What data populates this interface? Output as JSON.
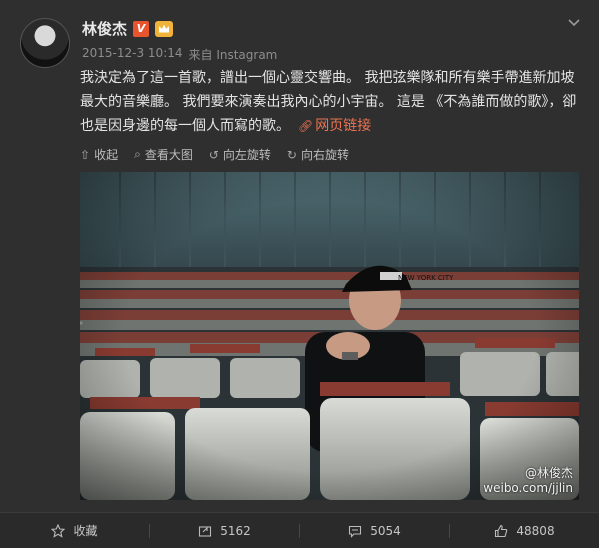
{
  "post": {
    "author_name": "林俊杰",
    "verified_badge": "V",
    "timestamp": "2015-12-3 10:14",
    "source": "来自 Instagram",
    "text": "我決定為了這一首歌，譜出一個心靈交響曲。 我把弦樂隊和所有樂手帶進新加坡最大的音樂廳。 我們要來演奏出我內心的小宇宙。 這是 《不為誰而做的歌》，卻也是因身邊的每一個人而寫的歌。",
    "link_label": "网页链接",
    "link_icon": "link-icon"
  },
  "image_toolbar": {
    "collapse": "收起",
    "view_large": "查看大图",
    "rotate_left": "向左旋转",
    "rotate_right": "向右旋转"
  },
  "photo": {
    "cap_text": "NEW YORK CITY",
    "watermark_line1": "@林俊杰",
    "watermark_line2": "weibo.com/jjlin"
  },
  "actions": {
    "favorite": "收藏",
    "repost": "5162",
    "comment": "5054",
    "like": "48808"
  },
  "colors": {
    "background": "#2f2f2f",
    "accent_link": "#eb7350",
    "verified": "#e8542e"
  }
}
